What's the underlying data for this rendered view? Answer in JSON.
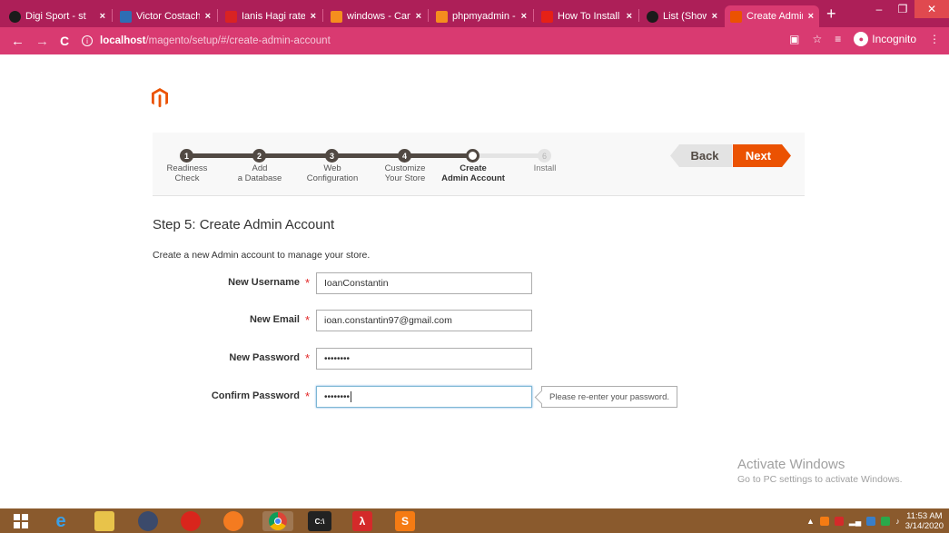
{
  "browser": {
    "tabs": [
      {
        "title": "Digi Sport - st",
        "favicon_color": "#1b1b1b"
      },
      {
        "title": "Victor Costache",
        "favicon_color": "#2e6db4"
      },
      {
        "title": "Ianis Hagi rate",
        "favicon_color": "#d92323"
      },
      {
        "title": "windows - Can",
        "favicon_color": "#f58e1e"
      },
      {
        "title": "phpmyadmin -",
        "favicon_color": "#f58e1e"
      },
      {
        "title": "How To Install",
        "favicon_color": "#e62117"
      },
      {
        "title": "List (Show) Tab",
        "favicon_color": "#1b1b1b"
      },
      {
        "title": "Create Admin A",
        "favicon_color": "#eb5202"
      }
    ],
    "tab_close": "×",
    "new_tab": "+",
    "url_host": "localhost",
    "url_path": "/magento/setup/#/create-admin-account",
    "incognito_label": "Incognito"
  },
  "wizard": {
    "steps": [
      {
        "number": "1",
        "label": "Readiness\nCheck",
        "state": "done"
      },
      {
        "number": "2",
        "label": "Add\na Database",
        "state": "done"
      },
      {
        "number": "3",
        "label": "Web\nConfiguration",
        "state": "done"
      },
      {
        "number": "4",
        "label": "Customize\nYour Store",
        "state": "done"
      },
      {
        "number": "5",
        "label": "Create\nAdmin Account",
        "state": "current"
      },
      {
        "number": "6",
        "label": "Install",
        "state": "future"
      }
    ],
    "back_label": "Back",
    "next_label": "Next"
  },
  "page": {
    "title": "Step 5: Create Admin Account",
    "intro": "Create a new Admin account to manage your store.",
    "required_mark": "*",
    "fields": {
      "username": {
        "label": "New Username",
        "value": "IoanConstantin"
      },
      "email": {
        "label": "New Email",
        "value": "ioan.constantin97@gmail.com"
      },
      "password": {
        "label": "New Password",
        "value": "••••••••"
      },
      "confirm": {
        "label": "Confirm Password",
        "value": "••••••••",
        "hint": "Please re-enter your password."
      }
    }
  },
  "watermark": {
    "line1": "Activate Windows",
    "line2": "Go to PC settings to activate Windows."
  },
  "taskbar": {
    "time": "11:53 AM",
    "date": "3/14/2020"
  },
  "colors": {
    "chrome_tabstrip": "#ad1f58",
    "chrome_toolbar": "#d93a71",
    "magento_orange": "#eb5202",
    "step_dark": "#514943"
  }
}
